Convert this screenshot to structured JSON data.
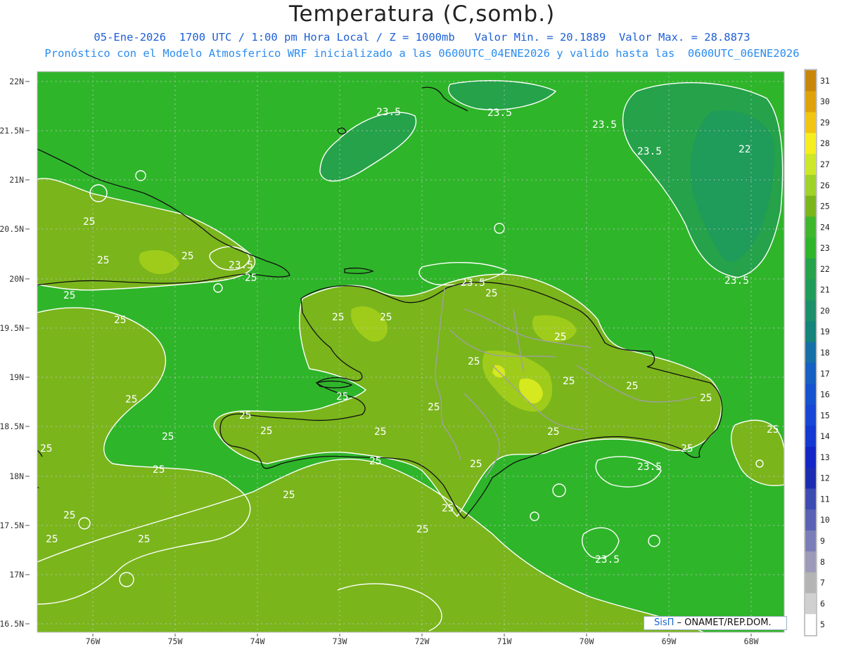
{
  "header": {
    "title": "Temperatura (C,somb.)",
    "subtitle_line1": "05-Ene-2026  1700 UTC / 1:00 pm Hora Local / Z = 1000mb   Valor Min. = 20.1889  Valor Max. = 28.8873",
    "subtitle_line2": "Pronóstico con el Modelo Atmosferico WRF inicializado a las 0600UTC_04ENE2026 y valido hasta las  0600UTC_06ENE2026"
  },
  "colors": {
    "title": "#222222",
    "subtitle": "#1e5fd6",
    "ocean": "#2fb52a",
    "land_warm": "#7ab51c",
    "land_hot": "#9fcc1a",
    "peak": "#d6e81e",
    "cool_band": "#25a24a",
    "colder_band": "#1f9b5a",
    "contour": "#ffffff",
    "coast": "#111111",
    "border": "#a0a0a0",
    "grid": "#c8c8c8"
  },
  "map": {
    "lat_labels": [
      "22N",
      "21.5N",
      "21N",
      "20.5N",
      "20N",
      "19.5N",
      "19N",
      "18.5N",
      "18N",
      "17.5N",
      "17N",
      "16.5N"
    ],
    "lon_labels": [
      "76W",
      "75W",
      "74W",
      "73W",
      "72W",
      "71W",
      "70W",
      "69W",
      "68W"
    ],
    "contour_labels": [
      "23.5",
      "23.5",
      "23.5",
      "23.5",
      "22",
      "25",
      "25",
      "23.5",
      "25",
      "23.5",
      "25",
      "25",
      "25",
      "23.5",
      "25",
      "25",
      "25",
      "25",
      "25",
      "25",
      "25",
      "25",
      "25",
      "25",
      "25",
      "25",
      "25",
      "25",
      "25",
      "25",
      "25",
      "25",
      "23.5",
      "25",
      "25",
      "25",
      "25",
      "25",
      "25",
      "25",
      "23.5",
      "25",
      "25",
      "25"
    ]
  },
  "colorbar": {
    "levels": [
      "31",
      "30",
      "29",
      "28",
      "27",
      "26",
      "25",
      "24",
      "23",
      "22",
      "21",
      "20",
      "19",
      "18",
      "17",
      "16",
      "15",
      "14",
      "13",
      "12",
      "11",
      "10",
      "9",
      "8",
      "7",
      "6",
      "5"
    ],
    "colors": [
      "#c8870a",
      "#e0a20a",
      "#f2c413",
      "#f6ee21",
      "#cde828",
      "#9fd22a",
      "#7ab51c",
      "#3eb72c",
      "#2fb52a",
      "#25a24a",
      "#1f9b5a",
      "#1b8f6a",
      "#15847a",
      "#1570a8",
      "#1560c2",
      "#1552cf",
      "#1646d6",
      "#1438d2",
      "#1226c8",
      "#1c2cb2",
      "#3d4cb2",
      "#5962b4",
      "#7a7eb8",
      "#9c9ab8",
      "#b4b4b4",
      "#d0d0d0",
      "#ffffff"
    ]
  },
  "credit": {
    "logo": "SisΠ",
    "text": " – ONAMET/REP.DOM."
  }
}
